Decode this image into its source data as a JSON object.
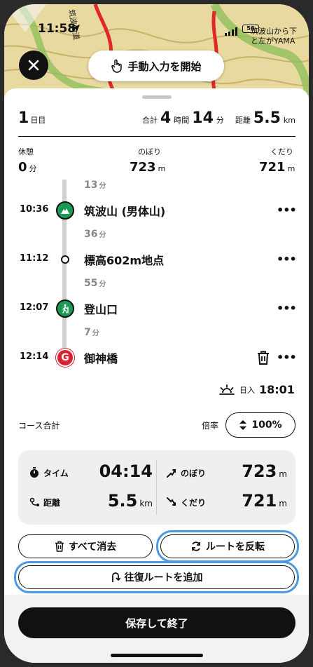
{
  "status": {
    "time": "11:58",
    "battery": "50"
  },
  "map": {
    "road_label": "筑波山道",
    "place_label_line1": "筑波山から下",
    "place_label_line2": "と左がYAMA"
  },
  "top": {
    "manual_input_label": "手動入力を開始"
  },
  "day": {
    "number": "1",
    "unit": "日目",
    "total_label": "合計",
    "hours": "4",
    "hours_unit": "時間",
    "minutes": "14",
    "minutes_unit": "分",
    "distance_label": "距離",
    "distance": "5.5",
    "distance_unit": "km"
  },
  "stats": {
    "rest_label": "休憩",
    "rest_value": "0",
    "rest_unit": "分",
    "up_label": "のぼり",
    "up_value": "723",
    "up_unit": "m",
    "down_label": "くだり",
    "down_value": "721",
    "down_unit": "m"
  },
  "timeline": {
    "segments": [
      {
        "value": "13",
        "unit": "分"
      },
      {
        "value": "36",
        "unit": "分"
      },
      {
        "value": "55",
        "unit": "分"
      },
      {
        "value": "7",
        "unit": "分"
      }
    ],
    "waypoints": [
      {
        "time": "10:36",
        "name": "筑波山 (男体山)",
        "more": "•••"
      },
      {
        "time": "11:12",
        "name": "標高602m地点",
        "more": "•••"
      },
      {
        "time": "12:07",
        "name": "登山口",
        "more": "•••"
      },
      {
        "time": "12:14",
        "name": "御神橋",
        "more": "•••",
        "goal_mark": "G"
      }
    ]
  },
  "sunset": {
    "label": "日入",
    "time": "18:01"
  },
  "course": {
    "label": "コース合計",
    "rate_label": "倍率",
    "rate_value": "100%"
  },
  "summary": {
    "time_label": "タイム",
    "time_value": "04:14",
    "up_label": "のぼり",
    "up_value": "723",
    "up_unit": "m",
    "distance_label": "距離",
    "distance_value": "5.5",
    "distance_unit": "km",
    "down_label": "くだり",
    "down_value": "721",
    "down_unit": "m"
  },
  "actions": {
    "clear_all": "すべて消去",
    "reverse_route": "ルートを反転",
    "add_round_trip": "往復ルートを追加",
    "save_and_finish": "保存して終了"
  },
  "colors": {
    "accent_green": "#1a9b55",
    "goal_red": "#d9202e",
    "highlight_blue": "#4a98e6"
  }
}
